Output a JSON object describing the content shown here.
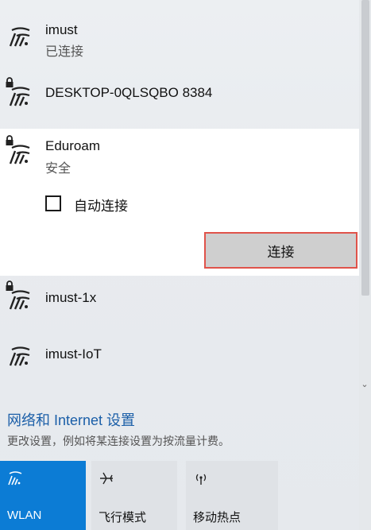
{
  "networks": [
    {
      "name": "imust",
      "status": "已连接",
      "secured": false
    },
    {
      "name": "DESKTOP-0QLSQBO 8384",
      "status": "",
      "secured": true
    },
    {
      "name": "Eduroam",
      "status": "安全",
      "secured": true,
      "expanded": true
    },
    {
      "name": "imust-1x",
      "status": "",
      "secured": true
    },
    {
      "name": "imust-IoT",
      "status": "",
      "secured": false
    }
  ],
  "expanded": {
    "auto_connect_label": "自动连接",
    "auto_connect_checked": false,
    "connect_label": "连接"
  },
  "settings": {
    "link": "网络和 Internet 设置",
    "description": "更改设置，例如将某连接设置为按流量计费。"
  },
  "quick_actions": [
    {
      "label": "WLAN",
      "icon": "wifi-icon",
      "active": true
    },
    {
      "label": "飞行模式",
      "icon": "airplane-icon",
      "active": false
    },
    {
      "label": "移动热点",
      "icon": "hotspot-icon",
      "active": false
    }
  ],
  "colors": {
    "accent": "#0c7cd5",
    "link": "#1b5fa8",
    "highlight_border": "#e0534a"
  }
}
